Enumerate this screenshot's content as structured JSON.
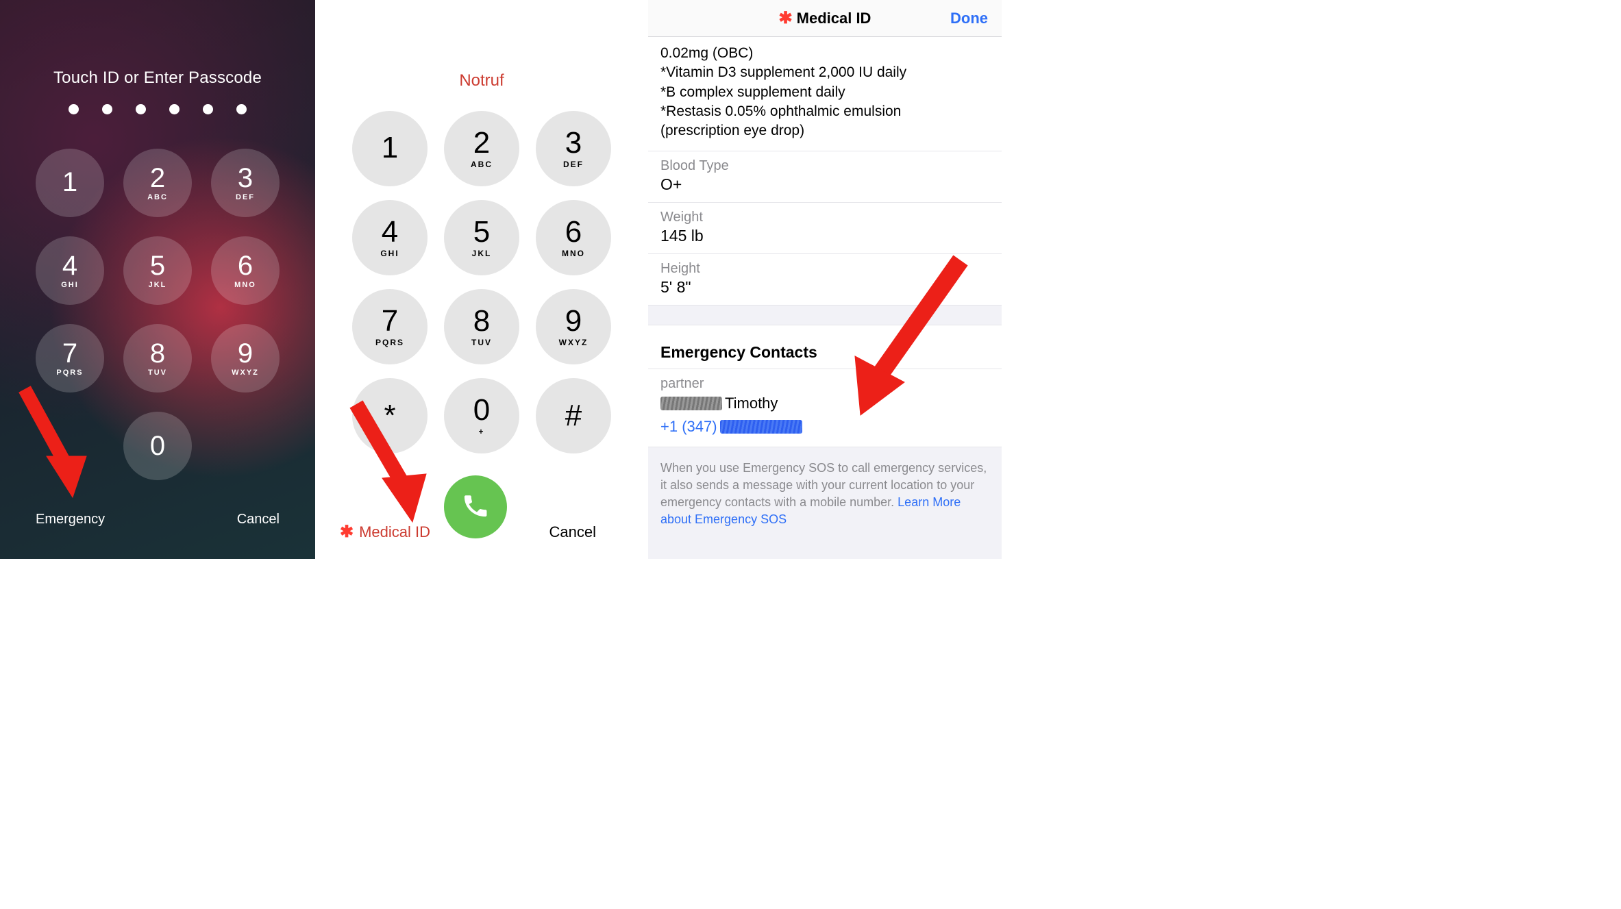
{
  "lockscreen": {
    "prompt": "Touch ID or Enter Passcode",
    "passcode_length": 6,
    "keys": [
      {
        "num": "1",
        "letters": ""
      },
      {
        "num": "2",
        "letters": "ABC"
      },
      {
        "num": "3",
        "letters": "DEF"
      },
      {
        "num": "4",
        "letters": "GHI"
      },
      {
        "num": "5",
        "letters": "JKL"
      },
      {
        "num": "6",
        "letters": "MNO"
      },
      {
        "num": "7",
        "letters": "PQRS"
      },
      {
        "num": "8",
        "letters": "TUV"
      },
      {
        "num": "9",
        "letters": "WXYZ"
      },
      {
        "num": "0",
        "letters": ""
      }
    ],
    "emergency_label": "Emergency",
    "cancel_label": "Cancel"
  },
  "dialpad": {
    "title": "Notruf",
    "keys": [
      {
        "num": "1",
        "letters": ""
      },
      {
        "num": "2",
        "letters": "ABC"
      },
      {
        "num": "3",
        "letters": "DEF"
      },
      {
        "num": "4",
        "letters": "GHI"
      },
      {
        "num": "5",
        "letters": "JKL"
      },
      {
        "num": "6",
        "letters": "MNO"
      },
      {
        "num": "7",
        "letters": "PQRS"
      },
      {
        "num": "8",
        "letters": "TUV"
      },
      {
        "num": "9",
        "letters": "WXYZ"
      },
      {
        "num": "*",
        "letters": ""
      },
      {
        "num": "0",
        "letters": "+"
      },
      {
        "num": "#",
        "letters": ""
      }
    ],
    "medical_id_label": "Medical ID",
    "cancel_label": "Cancel"
  },
  "medical": {
    "header_title": "Medical ID",
    "done_label": "Done",
    "notes": {
      "line0": "0.02mg (OBC)",
      "line1": "*Vitamin D3 supplement 2,000 IU daily",
      "line2": "*B complex supplement daily",
      "line3": "*Restasis 0.05% ophthalmic emulsion",
      "line4": "(prescription eye drop)"
    },
    "blood_type": {
      "label": "Blood Type",
      "value": "O+"
    },
    "weight": {
      "label": "Weight",
      "value": "145 lb"
    },
    "height": {
      "label": "Height",
      "value": "5' 8\""
    },
    "emergency_contacts_label": "Emergency Contacts",
    "contact": {
      "relation": "partner",
      "name_suffix": "Timothy",
      "phone_prefix": "+1 (347)"
    },
    "sos_info_text": "When you use Emergency SOS to call emergency services, it also sends a message with your current location to your emergency contacts with a mobile number. ",
    "sos_link_text": "Learn More about Emergency SOS"
  }
}
